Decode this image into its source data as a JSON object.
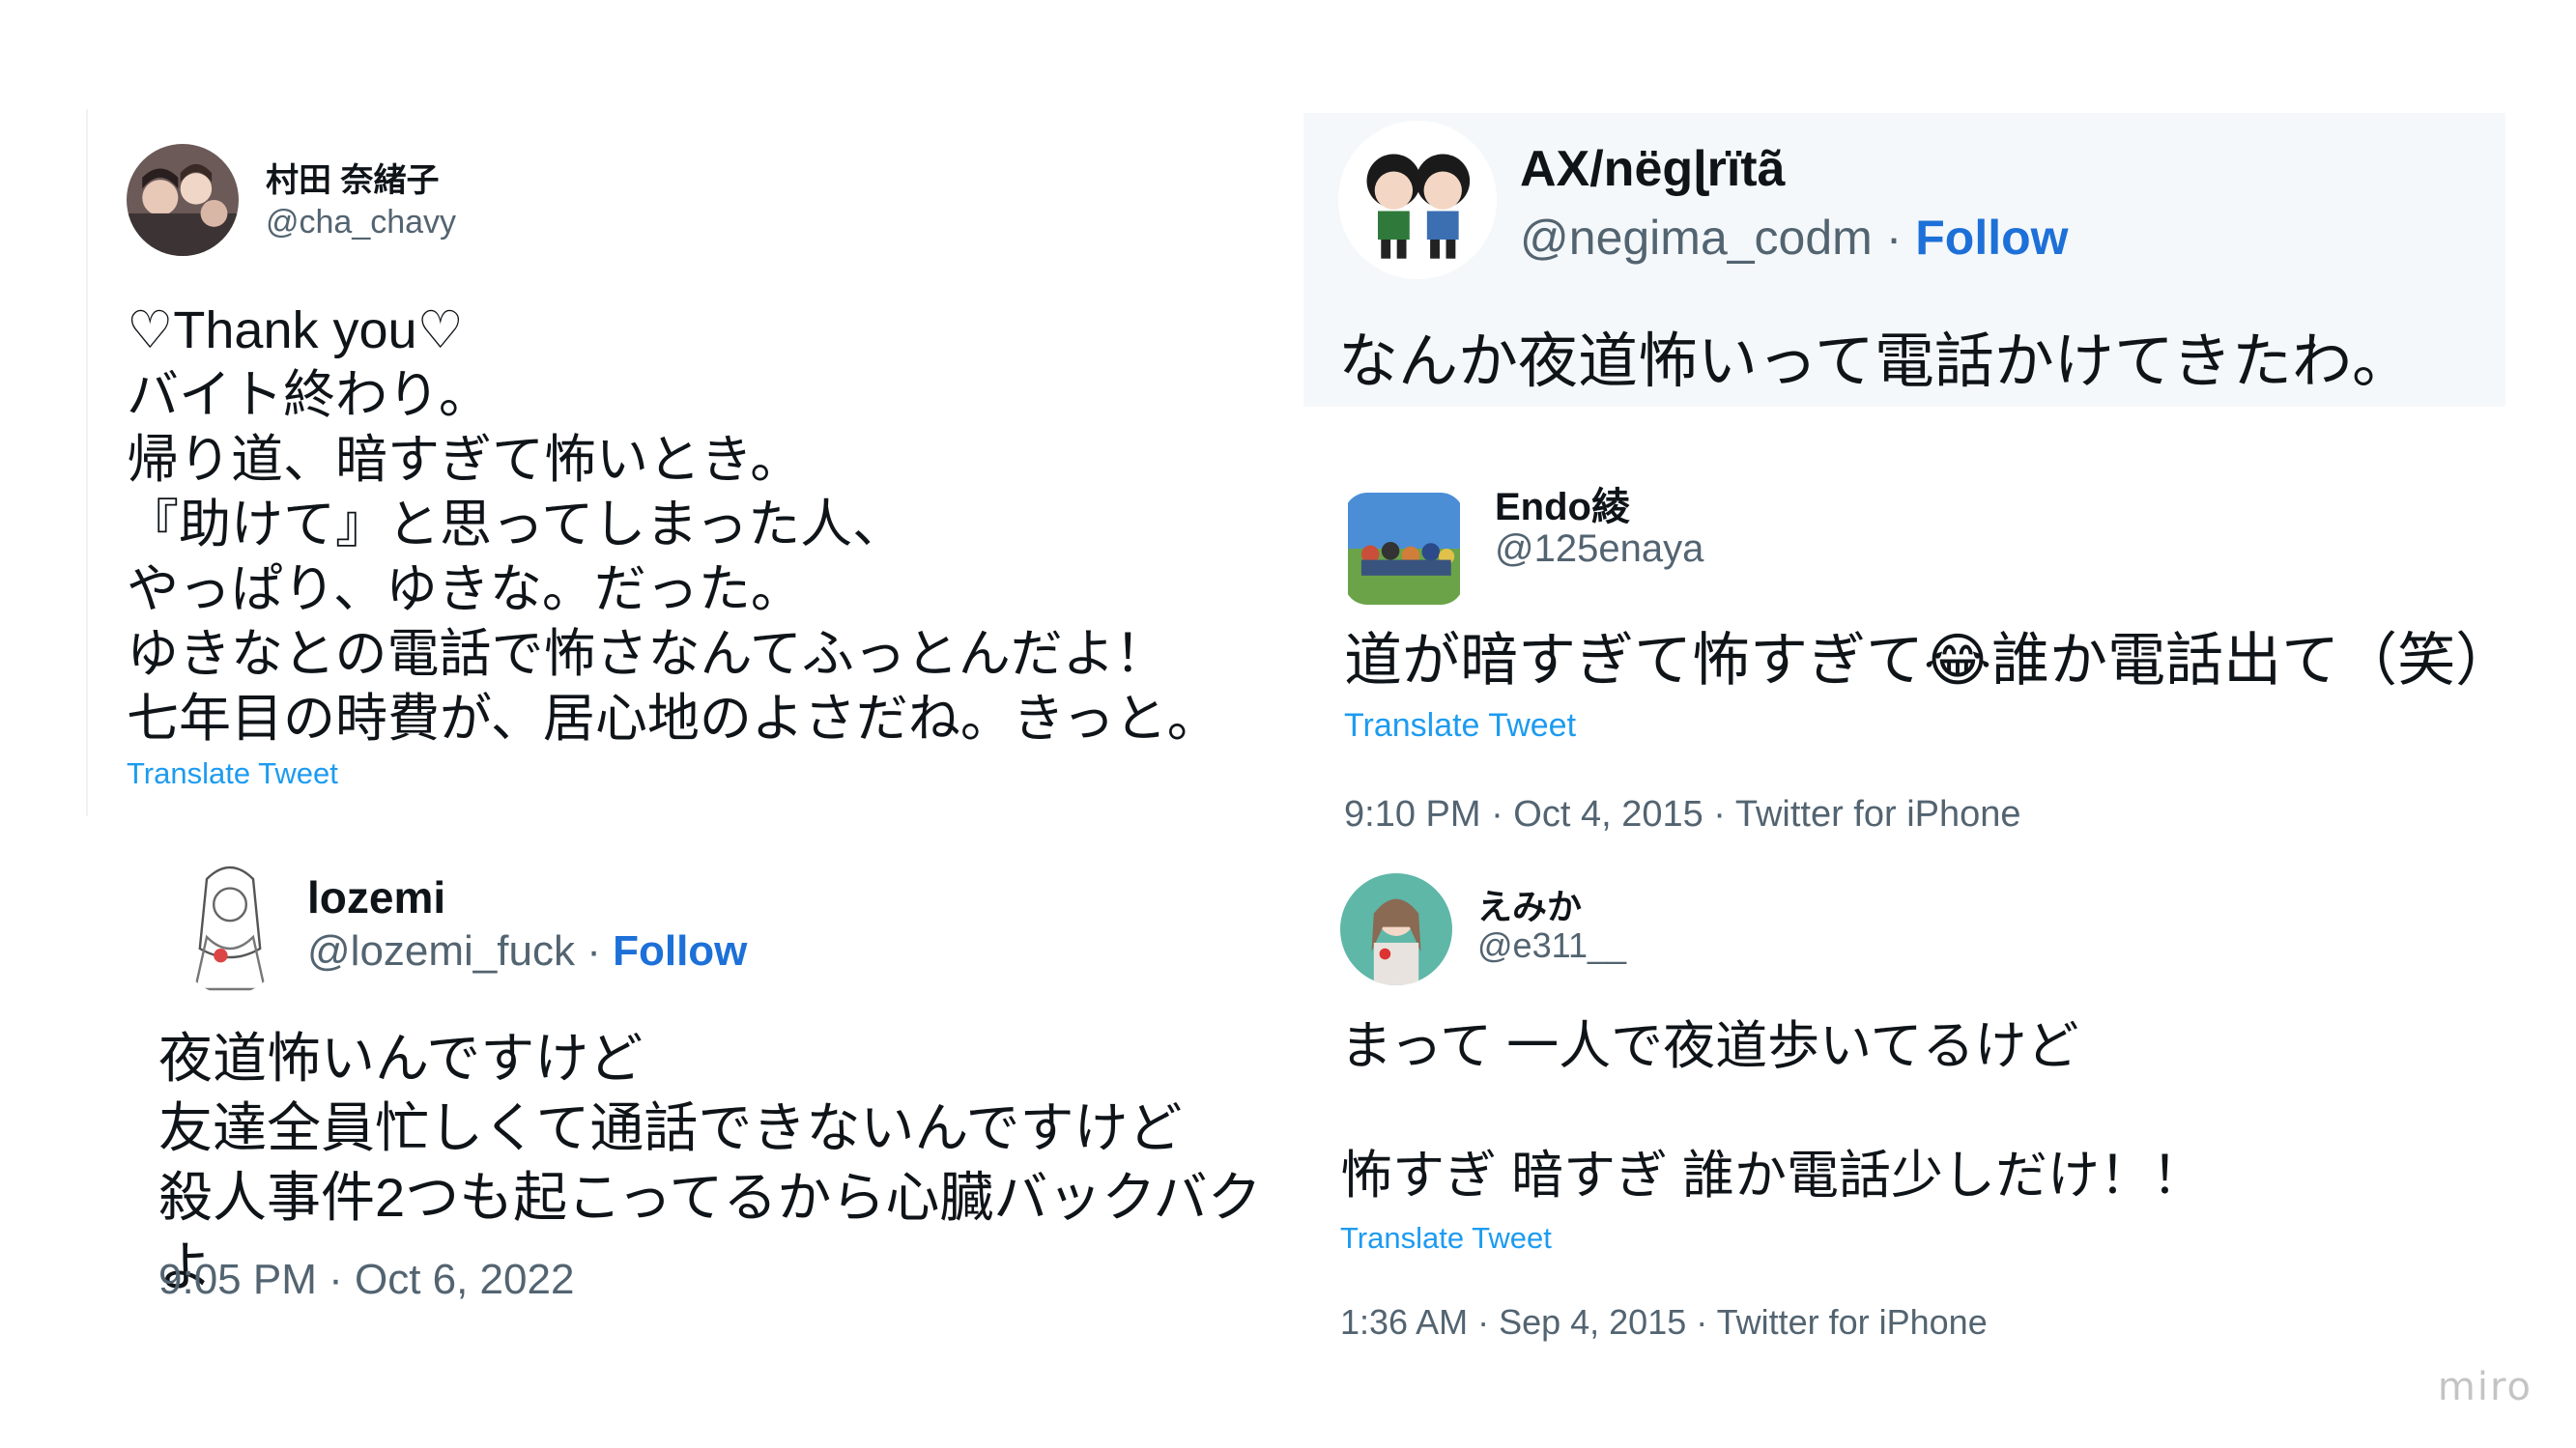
{
  "tweets": [
    {
      "name": "村田 奈緒子",
      "handle": "@cha_chavy",
      "lines": [
        "♡Thank you♡",
        "バイト終わり。",
        "帰り道、暗すぎて怖いとき。",
        "『助けて』と思ってしまった人、",
        "やっぱり、ゆきな。だった。",
        "ゆきなとの電話で怖さなんてふっとんだよ！",
        "七年目の時費が、居心地のよさだね。きっと。"
      ],
      "translate": "Translate Tweet"
    },
    {
      "name": "AX/nëgɭrïtã",
      "handle": "@negima_codm",
      "follow": "Follow",
      "lines": [
        "なんか夜道怖いって電話かけてきたわ。"
      ]
    },
    {
      "name": "Endo綾",
      "handle": "@125enaya",
      "lines": [
        "道が暗すぎて怖すぎて😂誰か電話出て（笑）"
      ],
      "translate": "Translate Tweet",
      "meta": "9:10 PM · Oct 4, 2015 · Twitter for iPhone"
    },
    {
      "name": "lozemi",
      "handle": "@lozemi_fuck",
      "follow": "Follow",
      "lines": [
        "夜道怖いんですけど",
        "友達全員忙しくて通話できないんですけど",
        "殺人事件2つも起こってるから心臓バックバクよ"
      ],
      "meta": "9:05 PM · Oct 6, 2022"
    },
    {
      "name": "えみか",
      "handle": "@e311__",
      "lines": [
        "まって 一人で夜道歩いてるけど",
        "",
        "怖すぎ 暗すぎ 誰か電話少しだけ！！"
      ],
      "translate": "Translate Tweet",
      "meta": "1:36 AM · Sep 4, 2015 · Twitter for iPhone"
    }
  ],
  "watermark": "miro",
  "colors": {
    "link": "#1d9bf0",
    "follow": "#1d70d8",
    "secondary": "#536471",
    "highlight_bg": "#f5f8fa"
  }
}
